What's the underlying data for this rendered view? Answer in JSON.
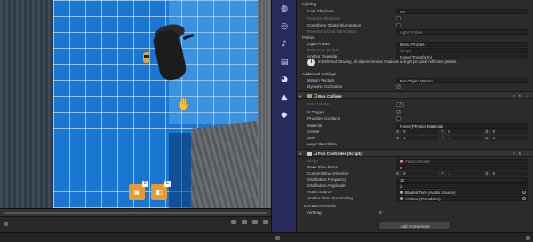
{
  "scene": {
    "gizmo_a_tag": "C",
    "gizmo_b_tag": "L"
  },
  "toolbar": {
    "icons": [
      "globe-icon",
      "ring-icon",
      "music-icon",
      "layers-icon",
      "cat-icon",
      "mountain-icon",
      "cube-edit-icon"
    ]
  },
  "inspector": {
    "lighting": {
      "header": "Lighting",
      "cast_shadows_label": "Cast Shadows",
      "cast_shadows_value": "On",
      "receive_shadows_label": "Receive Shadows",
      "contribute_gi_label": "Contribute Global Illumination",
      "receive_gi_label": "Receive Global Illumination",
      "receive_gi_value": "Light Probes"
    },
    "probes": {
      "header": "Probes",
      "light_probes_label": "Light Probes",
      "light_probes_value": "Blend Probes",
      "reflection_probes_label": "Reflection Probes",
      "reflection_probes_value": "Simple",
      "anchor_override_label": "Anchor Override",
      "anchor_override_value": "None (Transform)",
      "info_text": "In Deferred Shading, all objects receive shadows and get per-pixel reflection probes."
    },
    "additional": {
      "header": "Additional Settings",
      "motion_vectors_label": "Motion Vectors",
      "motion_vectors_value": "Per Object Motion",
      "dynamic_occlusion_label": "Dynamic Occlusion"
    },
    "box_collider": {
      "title": "Box Collider",
      "edit_collider_label": "Edit Collider",
      "is_trigger_label": "Is Trigger",
      "provides_contacts_label": "Provides Contacts",
      "material_label": "Material",
      "material_value": "None (Physics Material)",
      "center_label": "Center",
      "size_label": "Size",
      "center": {
        "x": "0",
        "y": "0",
        "z": "0"
      },
      "size": {
        "x": "1",
        "y": "1",
        "z": "1"
      },
      "layer_overrides_label": "Layer Overrides"
    },
    "fan_controller": {
      "title": "Fan Controller (Script)",
      "script_label": "Script",
      "script_value": "FanController",
      "base_blow_force_label": "Base Blow Force",
      "base_blow_force_value": "8",
      "custom_blow_direction_label": "Custom Blow Direction",
      "custom_blow_direction": {
        "x": "0",
        "y": "1",
        "z": "0"
      },
      "oscillation_frequency_label": "Oscillation Frequency",
      "oscillation_frequency_value": "10",
      "oscillation_amplitude_label": "Oscillation Amplitude",
      "oscillation_amplitude_value": "2",
      "audio_source_label": "Audio Source",
      "audio_source_value": "Blades Turn (Audio Source)",
      "anchor_point_label": "Anchor Point For Scaling",
      "anchor_point_value": "Anchor (Transform)",
      "net_reload_fields_label": "Net Reload Fields",
      "air_drag_label": "AirDrag",
      "air_drag_value": "0"
    },
    "add_component": "Add Component"
  },
  "colors": {
    "toolbar_bg": "#2a2a5a",
    "inspector_bg": "#2b2b2b",
    "accent_orange": "#e89a2a"
  }
}
